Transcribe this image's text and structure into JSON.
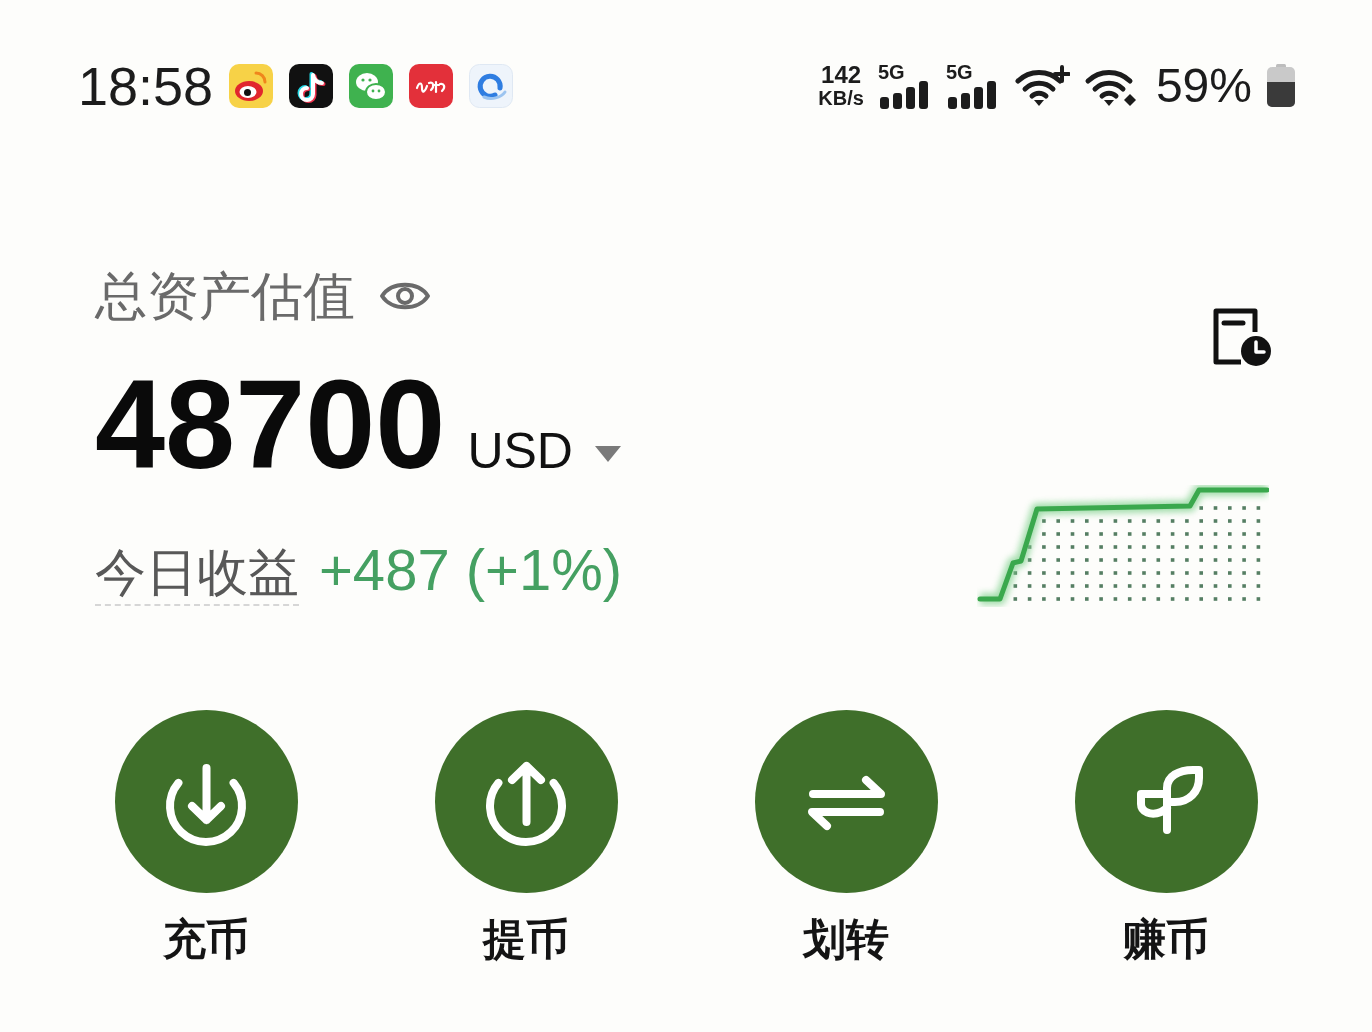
{
  "status_bar": {
    "time": "18:58",
    "net_speed": {
      "value": "142",
      "unit": "KB/s"
    },
    "signals": [
      {
        "label": "5G"
      },
      {
        "label": "5G"
      }
    ],
    "battery": "59%"
  },
  "assets": {
    "title": "总资产估值",
    "amount": "48700",
    "currency": "USD",
    "today": {
      "label": "今日收益",
      "change": "+487 (+1%)"
    }
  },
  "actions": [
    {
      "kind": "deposit",
      "label": "充币"
    },
    {
      "kind": "withdraw",
      "label": "提币"
    },
    {
      "kind": "transfer",
      "label": "划转"
    },
    {
      "kind": "earn",
      "label": "赚币"
    }
  ]
}
